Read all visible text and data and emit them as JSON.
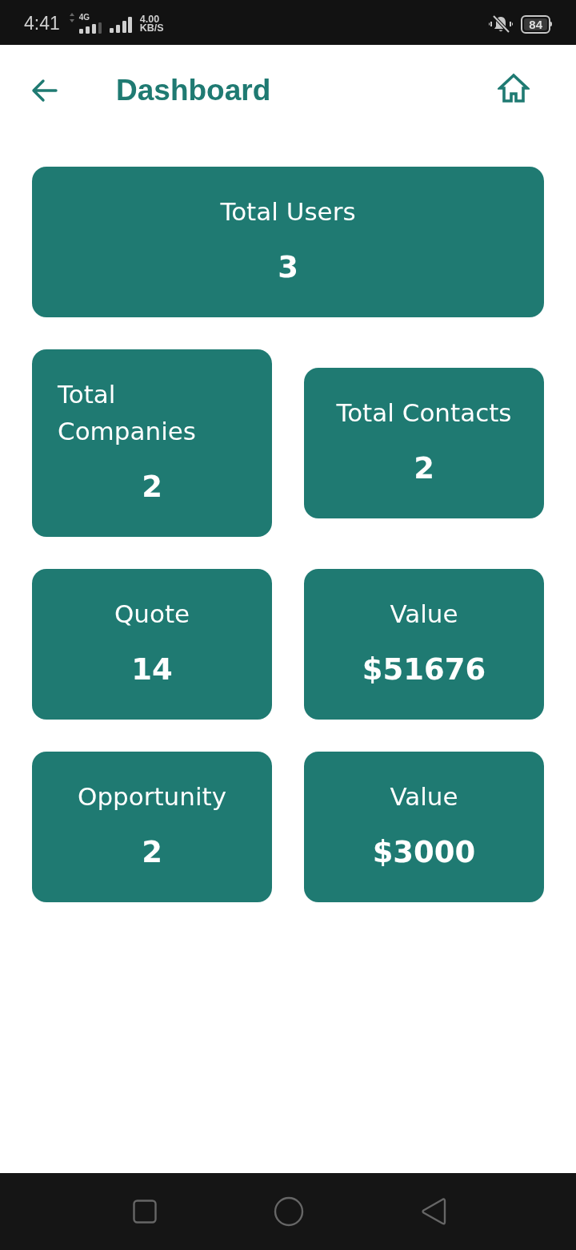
{
  "status_bar": {
    "time": "4:41",
    "network": "4G",
    "speed": "4.00",
    "speed_unit": "KB/S",
    "battery": "84"
  },
  "header": {
    "title": "Dashboard"
  },
  "cards": [
    {
      "kind": "wide",
      "label": "Total Users",
      "value": "3"
    },
    {
      "kind": "half",
      "label": "Total Companies",
      "value": "2"
    },
    {
      "kind": "half",
      "label": "Total Contacts",
      "value": "2"
    },
    {
      "kind": "half",
      "label": "Quote",
      "value": "14"
    },
    {
      "kind": "half",
      "label": "Value",
      "value": "$51676"
    },
    {
      "kind": "half",
      "label": "Opportunity",
      "value": "2"
    },
    {
      "kind": "half",
      "label": "Value",
      "value": "$3000"
    }
  ]
}
